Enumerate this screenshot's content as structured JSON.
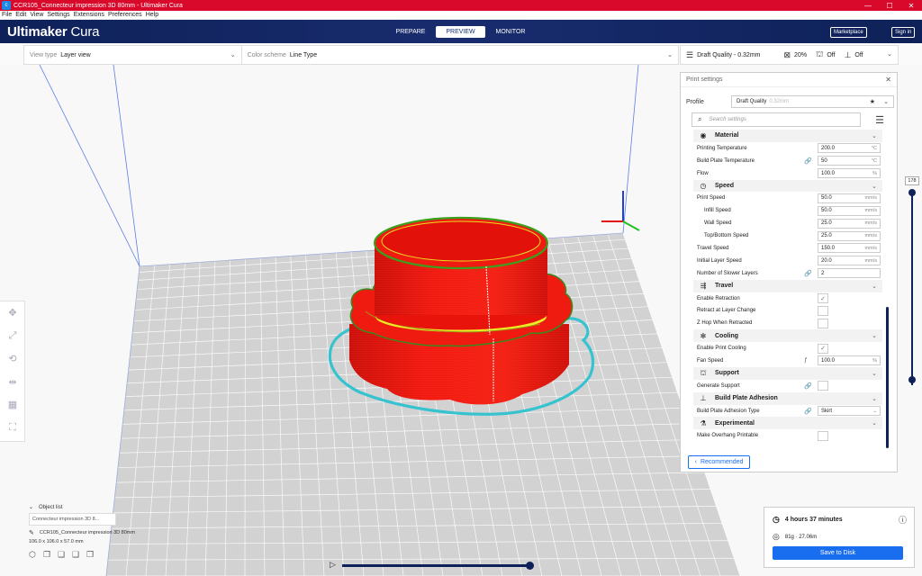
{
  "window": {
    "title": "CCR105_Connecteur impression 3D 80mm - Ultimaker Cura",
    "app_icon_glyph": "c",
    "controls": {
      "minimize": "—",
      "maximize": "☐",
      "close": "✕"
    }
  },
  "menu": [
    "File",
    "Edit",
    "View",
    "Settings",
    "Extensions",
    "Preferences",
    "Help"
  ],
  "header": {
    "logo_bold": "Ultimaker",
    "logo_light": " Cura",
    "stages": [
      {
        "label": "PREPARE",
        "active": false
      },
      {
        "label": "PREVIEW",
        "active": true
      },
      {
        "label": "MONITOR",
        "active": false
      }
    ],
    "marketplace": "Marketplace",
    "signin": "Sign in"
  },
  "toolbar": {
    "view_type_label": "View type",
    "view_type_value": "Layer view",
    "color_scheme_label": "Color scheme",
    "color_scheme_value": "Line Type",
    "quality": "Draft Quality - 0.32mm",
    "infill": "20%",
    "support": "Off",
    "adhesion": "Off"
  },
  "print_settings": {
    "title": "Print settings",
    "profile_label": "Profile",
    "profile_value": "Draft Quality",
    "profile_sub": "0.32mm",
    "search_placeholder": "Search settings",
    "recommended": "Recommended",
    "rows": [
      {
        "kind": "cat",
        "title": "Material",
        "icon": "◉"
      },
      {
        "kind": "field",
        "label": "Printing Temperature",
        "value": "200.0",
        "unit": "°C"
      },
      {
        "kind": "field",
        "label": "Build Plate Temperature",
        "value": "50",
        "unit": "°C",
        "link": "🔗"
      },
      {
        "kind": "field",
        "label": "Flow",
        "value": "100.0",
        "unit": "%"
      },
      {
        "kind": "cat",
        "title": "Speed",
        "icon": "◷"
      },
      {
        "kind": "field",
        "label": "Print Speed",
        "value": "50.0",
        "unit": "mm/s"
      },
      {
        "kind": "field",
        "label": "Infill Speed",
        "value": "50.0",
        "unit": "mm/s",
        "sub": true
      },
      {
        "kind": "field",
        "label": "Wall Speed",
        "value": "25.0",
        "unit": "mm/s",
        "sub": true
      },
      {
        "kind": "field",
        "label": "Top/Bottom Speed",
        "value": "25.0",
        "unit": "mm/s",
        "sub": true
      },
      {
        "kind": "field",
        "label": "Travel Speed",
        "value": "150.0",
        "unit": "mm/s"
      },
      {
        "kind": "field",
        "label": "Initial Layer Speed",
        "value": "20.0",
        "unit": "mm/s"
      },
      {
        "kind": "field",
        "label": "Number of Slower Layers",
        "value": "2",
        "unit": "",
        "link": "🔗"
      },
      {
        "kind": "cat",
        "title": "Travel",
        "icon": "⇶"
      },
      {
        "kind": "check",
        "label": "Enable Retraction",
        "checked": true
      },
      {
        "kind": "check",
        "label": "Retract at Layer Change",
        "checked": false
      },
      {
        "kind": "check",
        "label": "Z Hop When Retracted",
        "checked": false
      },
      {
        "kind": "cat",
        "title": "Cooling",
        "icon": "✻"
      },
      {
        "kind": "check",
        "label": "Enable Print Cooling",
        "checked": true
      },
      {
        "kind": "field",
        "label": "Fan Speed",
        "value": "100.0",
        "unit": "%",
        "link": "ƒ"
      },
      {
        "kind": "cat",
        "title": "Support",
        "icon": "⛫"
      },
      {
        "kind": "check",
        "label": "Generate Support",
        "checked": false,
        "link": "🔗"
      },
      {
        "kind": "cat",
        "title": "Build Plate Adhesion",
        "icon": "⊥"
      },
      {
        "kind": "field",
        "label": "Build Plate Adhesion Type",
        "value": "Skirt",
        "unit": "⌄",
        "link": "🔗"
      },
      {
        "kind": "cat",
        "title": "Experimental",
        "icon": "⚗"
      },
      {
        "kind": "check",
        "label": "Make Overhang Printable",
        "checked": false
      }
    ]
  },
  "layer_slider": {
    "value": "178"
  },
  "object_list": {
    "title": "Object list",
    "item": "Connecteur impression 3D 8...",
    "file": "CCR105_Connecteur impression 3D 80mm",
    "dims": "106.0 x 106.0 x 57.0 mm"
  },
  "print_info": {
    "time": "4 hours 37 minutes",
    "material": "81g · 27.06m",
    "save": "Save to Disk"
  },
  "colors": {
    "accent": "#196ef0",
    "header": "#0e2158",
    "titlebar": "#d9092b",
    "model_wall": "#e8110c",
    "model_infill": "#eaea1a",
    "skirt": "#39c2cf"
  }
}
